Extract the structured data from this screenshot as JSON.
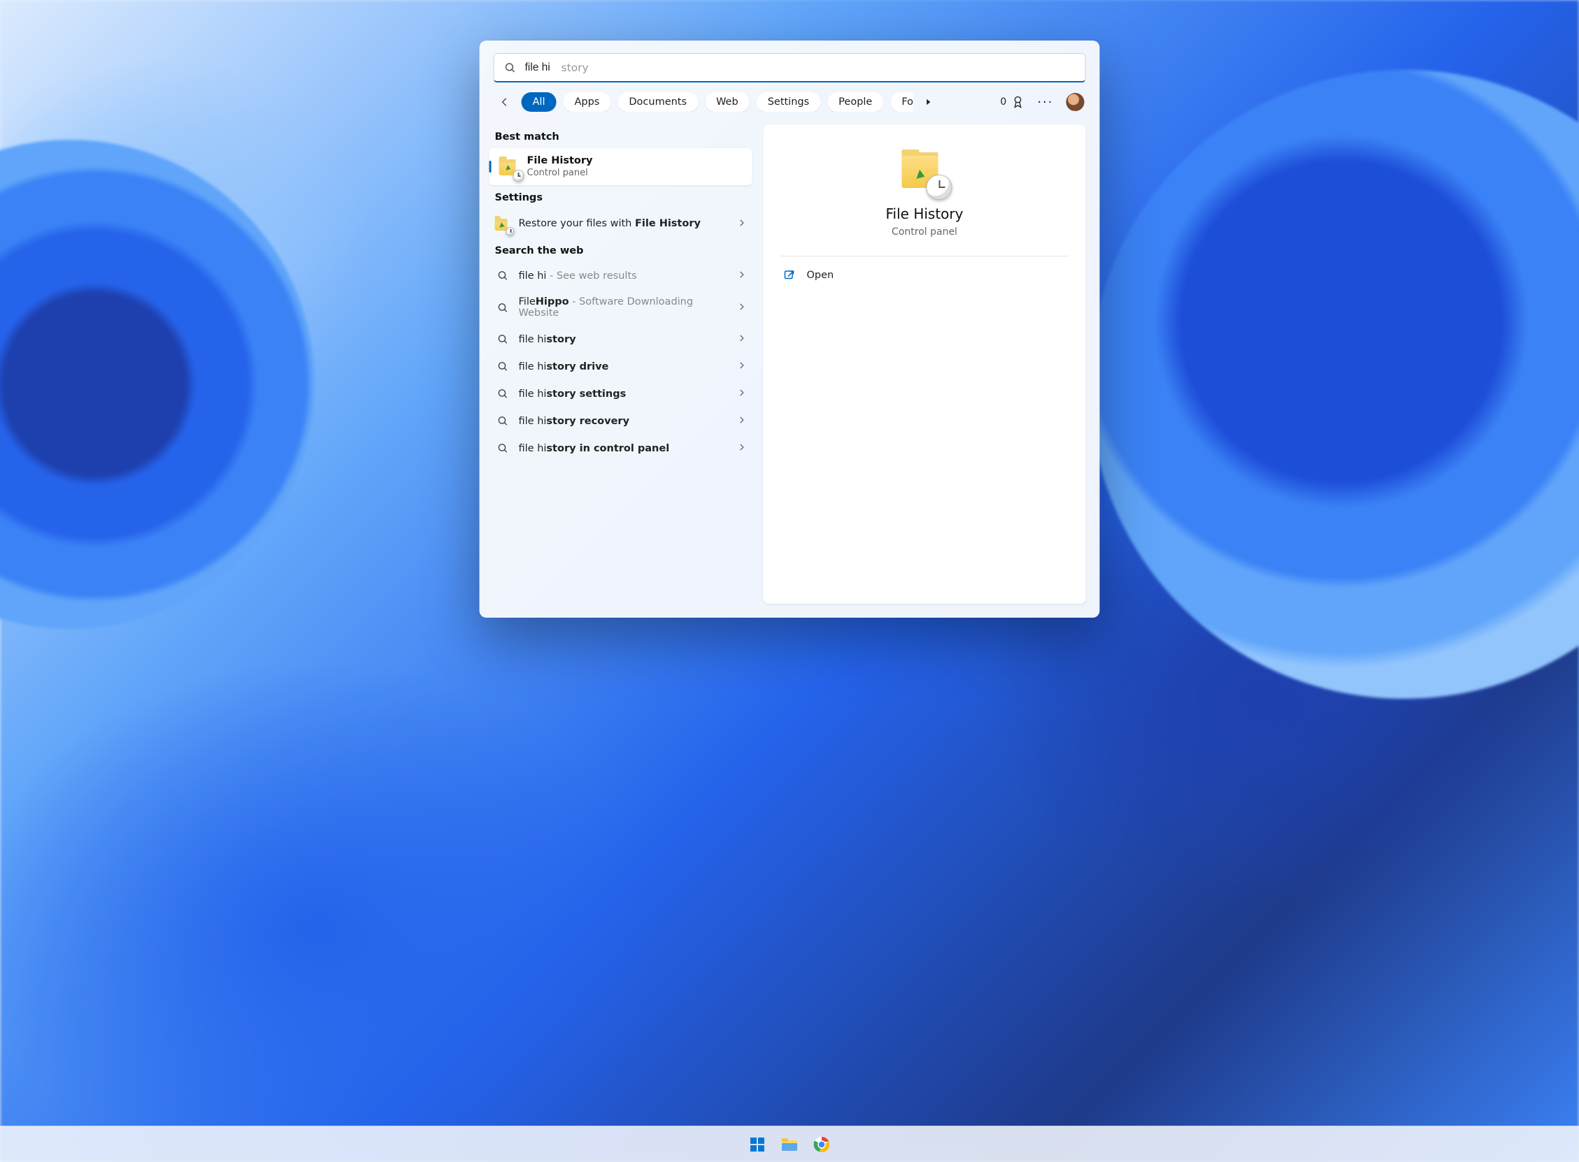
{
  "search": {
    "typed": "file hi",
    "completion": "story"
  },
  "filters": {
    "items": [
      "All",
      "Apps",
      "Documents",
      "Web",
      "Settings",
      "People",
      "Folders"
    ],
    "active_index": 0
  },
  "rewards": {
    "points": "0"
  },
  "sections": {
    "best_match_label": "Best match",
    "settings_label": "Settings",
    "web_label": "Search the web"
  },
  "best_match": {
    "title": "File History",
    "subtitle": "Control panel"
  },
  "settings_results": [
    {
      "lead": "Restore your files with ",
      "bold": "File History",
      "tail": ""
    }
  ],
  "web_results": [
    {
      "lead": "file hi",
      "bold": "",
      "hint": " - See web results"
    },
    {
      "lead": "File",
      "bold": "Hippo",
      "hint": " - Software Downloading Website"
    },
    {
      "lead": "file hi",
      "bold": "story",
      "hint": ""
    },
    {
      "lead": "file hi",
      "bold": "story drive",
      "hint": ""
    },
    {
      "lead": "file hi",
      "bold": "story settings",
      "hint": ""
    },
    {
      "lead": "file hi",
      "bold": "story recovery",
      "hint": ""
    },
    {
      "lead": "file hi",
      "bold": "story in control panel",
      "hint": ""
    }
  ],
  "preview": {
    "title": "File History",
    "subtitle": "Control panel",
    "open_label": "Open"
  },
  "taskbar": {
    "items": [
      "start",
      "file-explorer",
      "chrome"
    ]
  }
}
